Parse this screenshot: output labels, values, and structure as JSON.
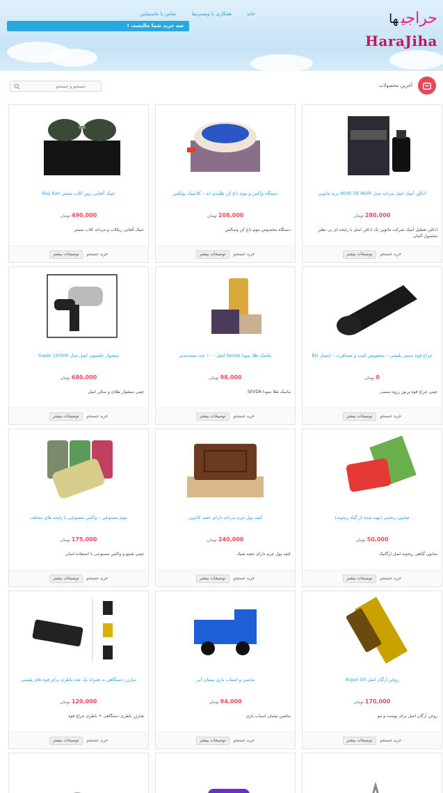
{
  "header": {
    "logo_fa": "حراجی",
    "logo_fa_suffix": "ها",
    "logo_en": "HaraJiha",
    "nav": [
      "خانه",
      "همکاری با ویستریط",
      "تماس با ماستیلس"
    ],
    "announcement": "سه خرید شما مالیست !"
  },
  "toolbar": {
    "latest_label": "آخرین محصولات",
    "search_placeholder": "جستجو و جستجو",
    "latest_icon": "shopping-bag-icon",
    "search_icon": "magnifier-icon"
  },
  "colors": {
    "accent": "#2a9fd8",
    "price": "#e84a5f",
    "brand": "#e91e8c"
  },
  "card_labels": {
    "more": "توضیحات بیشتر",
    "buy": "خرید جستجو",
    "currency": "تومان"
  },
  "products": [
    {
      "title": "ادکلن آنتیک اصل مردانه مدل NOIR DE NOIR برند ماتوین",
      "price": "280,000",
      "desc": "ادکلن تعطیل آنتیک شرکت ماتوین یک ادکلن اصل با رایحه ای بی نظیر محصول آلمان",
      "image": "perfume"
    },
    {
      "title": "دستگاه واکس و موم داغ کن طلیدی اند – کلاسیک پولکس",
      "price": "208,000",
      "desc": "دستگاه مخصوص موم داغ کن وسالس",
      "image": "wax-heater"
    },
    {
      "title": "عینک آفتابی ریبن کلاب مستر Ray Ban",
      "price": "490,000",
      "desc": "عینک آفتابی ریکلاب و مردانه کلاب مستر",
      "image": "sunglasses"
    },
    {
      "title": "چراغ قوه دستی پلیسی – مخصوص کمپ و مسافرت – انتشار BU",
      "price": "0",
      "desc": "چینی چراغ قوه پرنور رزوه سسی",
      "image": "flashlight"
    },
    {
      "title": "ماسک طلا سودا Sevda اصل – ۱۰ عدد بسته‌بندی",
      "price": "98,000",
      "desc": "ماسک طلا سودا SEVDA",
      "image": "gold-mask"
    },
    {
      "title": "سشوار حلسیون اصل مدل Super 1200W",
      "price": "680,000",
      "desc": "چینی سشوار طلای و سالن اصل",
      "image": "hair-dryer"
    },
    {
      "title": "صابون ریختنی (تهیه شده از گیاه ریحونه)",
      "price": "50,000",
      "desc": "صابون گیاهی ریحونه اصل ارگانیک",
      "image": "soap"
    },
    {
      "title": "کیف پول چرم مردانه دارای جعبه کادویی",
      "price": "240,000",
      "desc": "کیف پول چرم دارای جعبه شیک",
      "image": "wallet"
    },
    {
      "title": "موم مصنوعی – واکس مصنوعی با رایحه های مختلف",
      "price": "175,000",
      "desc": "چینی شینو و واکس مصنوعی با استفاده اسان",
      "image": "wax-beads"
    },
    {
      "title": "روغن آرگان اصل Argan Oil",
      "price": "170,000",
      "desc": "روغن آرگان اصل برای پوست و مو",
      "image": "argan-oil"
    },
    {
      "title": "ماشین و اسباب بازی نیسان آبی",
      "price": "94,000",
      "desc": "ماشین نیسان اسباب بازی",
      "image": "toy-truck"
    },
    {
      "title": "شارژر دستگاهی به همراه یک عدد باطری برای قوه های پلیسی",
      "price": "120,000",
      "desc": "شارژر باطری دستگاهی + باطری چراغ قوه",
      "image": "charger"
    }
  ]
}
